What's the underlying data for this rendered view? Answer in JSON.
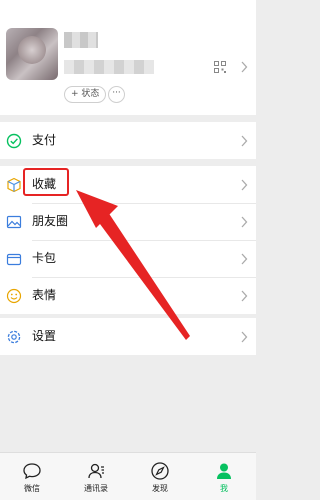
{
  "profile": {
    "status_label": "+ 状态",
    "more_label": "···"
  },
  "menu": {
    "pay": "支付",
    "favorites": "收藏",
    "moments": "朋友圈",
    "cards": "卡包",
    "stickers": "表情",
    "settings": "设置"
  },
  "tabs": [
    {
      "label": "微信",
      "icon": "chat-bubble-icon"
    },
    {
      "label": "通讯录",
      "icon": "contacts-icon"
    },
    {
      "label": "发现",
      "icon": "compass-icon"
    },
    {
      "label": "我",
      "icon": "person-icon"
    }
  ],
  "colors": {
    "accent": "#07c160",
    "annotation": "#e62424",
    "background": "#ededed"
  },
  "annotations": {
    "highlighted_item": "收藏"
  }
}
